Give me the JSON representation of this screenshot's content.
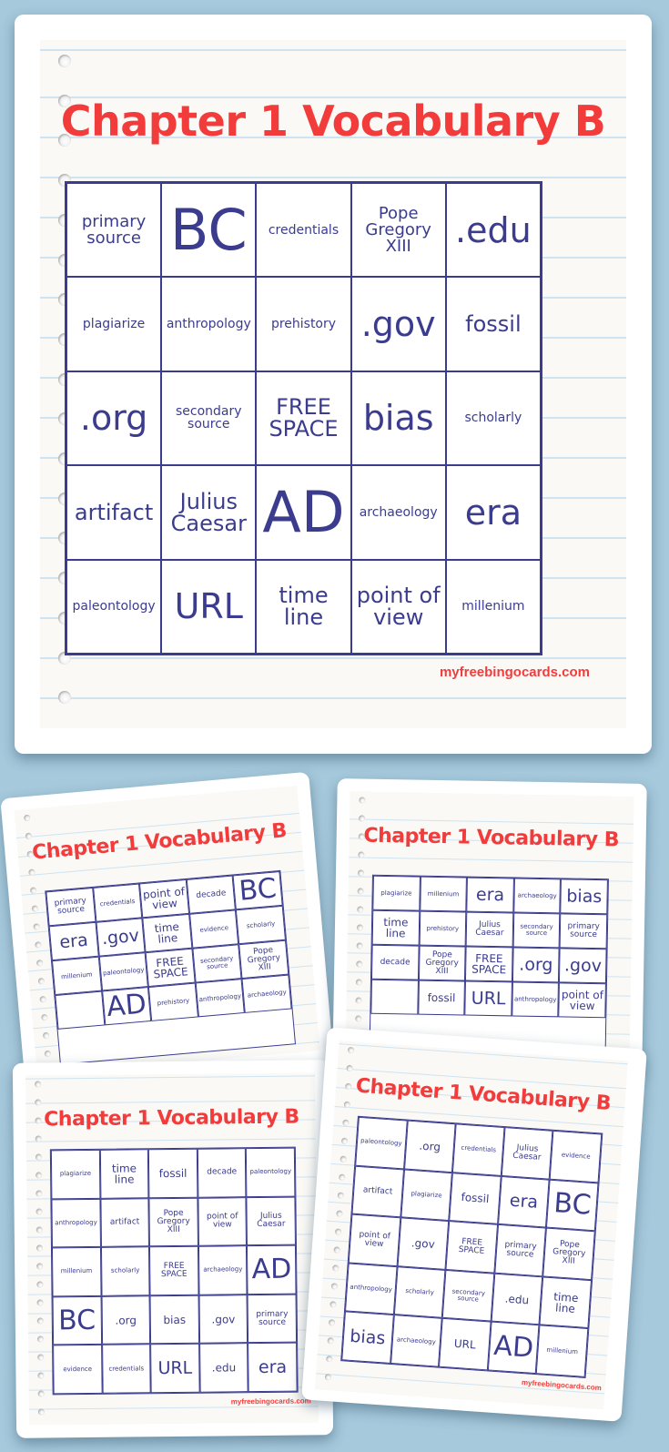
{
  "colors": {
    "background": "#a6c9dc",
    "title": "#f23c3c",
    "grid_ink": "#3b3c8e",
    "paper": "#faf9f6",
    "rule_line": "#cfe3f1"
  },
  "main_card": {
    "title": "Chapter 1 Vocabulary B",
    "brand": "myfreebingocards.com",
    "cells": [
      {
        "text": "primary source",
        "size": "s"
      },
      {
        "text": "BC",
        "size": "xl"
      },
      {
        "text": "credentials",
        "size": "xs"
      },
      {
        "text": "Pope Gregory XIII",
        "size": "s"
      },
      {
        "text": ".edu",
        "size": "l"
      },
      {
        "text": "plagiarize",
        "size": "xs"
      },
      {
        "text": "anthropology",
        "size": "xs"
      },
      {
        "text": "prehistory",
        "size": "xs"
      },
      {
        "text": ".gov",
        "size": "l"
      },
      {
        "text": "fossil",
        "size": "m"
      },
      {
        "text": ".org",
        "size": "l"
      },
      {
        "text": "secondary source",
        "size": "xs"
      },
      {
        "text": "FREE SPACE",
        "size": "m"
      },
      {
        "text": "bias",
        "size": "l"
      },
      {
        "text": "scholarly",
        "size": "xs"
      },
      {
        "text": "artifact",
        "size": "m"
      },
      {
        "text": "Julius Caesar",
        "size": "m"
      },
      {
        "text": "AD",
        "size": "xl"
      },
      {
        "text": "archaeology",
        "size": "xs"
      },
      {
        "text": "era",
        "size": "l"
      },
      {
        "text": "paleontology",
        "size": "xs"
      },
      {
        "text": "URL",
        "size": "l"
      },
      {
        "text": "time line",
        "size": "m"
      },
      {
        "text": "point of view",
        "size": "m"
      },
      {
        "text": "millenium",
        "size": "xs"
      }
    ]
  },
  "preview_cards": [
    {
      "title": "Chapter 1 Vocabulary B",
      "brand": "",
      "cells": [
        {
          "text": "primary source",
          "size": "s"
        },
        {
          "text": "credentials",
          "size": "xs"
        },
        {
          "text": "point of view",
          "size": "m"
        },
        {
          "text": "decade",
          "size": "s"
        },
        {
          "text": "BC",
          "size": "xl"
        },
        {
          "text": "era",
          "size": "l"
        },
        {
          "text": ".gov",
          "size": "l"
        },
        {
          "text": "time line",
          "size": "m"
        },
        {
          "text": "evidence",
          "size": "xs"
        },
        {
          "text": "scholarly",
          "size": "xs"
        },
        {
          "text": "millenium",
          "size": "xs"
        },
        {
          "text": "paleontology",
          "size": "xs"
        },
        {
          "text": "FREE SPACE",
          "size": "m"
        },
        {
          "text": "secondary source",
          "size": "xs"
        },
        {
          "text": "Pope Gregory XIII",
          "size": "s"
        },
        {
          "text": "",
          "size": "m"
        },
        {
          "text": "AD",
          "size": "xl"
        },
        {
          "text": "prehistory",
          "size": "xs"
        },
        {
          "text": "anthropology",
          "size": "xs"
        },
        {
          "text": "archaeology",
          "size": "xs"
        }
      ]
    },
    {
      "title": "Chapter 1 Vocabulary B",
      "brand": "",
      "cells": [
        {
          "text": "plagiarize",
          "size": "xs"
        },
        {
          "text": "millenium",
          "size": "xs"
        },
        {
          "text": "era",
          "size": "l"
        },
        {
          "text": "archaeology",
          "size": "xs"
        },
        {
          "text": "bias",
          "size": "l"
        },
        {
          "text": "time line",
          "size": "m"
        },
        {
          "text": "prehistory",
          "size": "xs"
        },
        {
          "text": "Julius Caesar",
          "size": "s"
        },
        {
          "text": "secondary source",
          "size": "xs"
        },
        {
          "text": "primary source",
          "size": "s"
        },
        {
          "text": "decade",
          "size": "s"
        },
        {
          "text": "Pope Gregory XIII",
          "size": "s"
        },
        {
          "text": "FREE SPACE",
          "size": "m"
        },
        {
          "text": ".org",
          "size": "l"
        },
        {
          "text": ".gov",
          "size": "l"
        },
        {
          "text": "",
          "size": "m"
        },
        {
          "text": "fossil",
          "size": "m"
        },
        {
          "text": "URL",
          "size": "l"
        },
        {
          "text": "anthropology",
          "size": "xs"
        },
        {
          "text": "point of view",
          "size": "m"
        }
      ]
    },
    {
      "title": "Chapter 1 Vocabulary B",
      "brand": "myfreebingocards.com",
      "cells": [
        {
          "text": "plagiarize",
          "size": "xs"
        },
        {
          "text": "time line",
          "size": "m"
        },
        {
          "text": "fossil",
          "size": "m"
        },
        {
          "text": "decade",
          "size": "s"
        },
        {
          "text": "paleontology",
          "size": "xs"
        },
        {
          "text": "anthropology",
          "size": "xs"
        },
        {
          "text": "artifact",
          "size": "s"
        },
        {
          "text": "Pope Gregory XIII",
          "size": "s"
        },
        {
          "text": "point of view",
          "size": "s"
        },
        {
          "text": "Julius Caesar",
          "size": "s"
        },
        {
          "text": "millenium",
          "size": "xs"
        },
        {
          "text": "scholarly",
          "size": "xs"
        },
        {
          "text": "FREE SPACE",
          "size": "s"
        },
        {
          "text": "archaeology",
          "size": "xs"
        },
        {
          "text": "AD",
          "size": "xl"
        },
        {
          "text": "BC",
          "size": "xl"
        },
        {
          "text": ".org",
          "size": "m"
        },
        {
          "text": "bias",
          "size": "m"
        },
        {
          "text": ".gov",
          "size": "m"
        },
        {
          "text": "primary source",
          "size": "s"
        },
        {
          "text": "evidence",
          "size": "xs"
        },
        {
          "text": "credentials",
          "size": "xs"
        },
        {
          "text": "URL",
          "size": "l"
        },
        {
          "text": ".edu",
          "size": "m"
        },
        {
          "text": "era",
          "size": "l"
        }
      ]
    },
    {
      "title": "Chapter 1 Vocabulary B",
      "brand": "myfreebingocards.com",
      "cells": [
        {
          "text": "paleontology",
          "size": "xs"
        },
        {
          "text": ".org",
          "size": "m"
        },
        {
          "text": "credentials",
          "size": "xs"
        },
        {
          "text": "Julius Caesar",
          "size": "s"
        },
        {
          "text": "evidence",
          "size": "xs"
        },
        {
          "text": "artifact",
          "size": "s"
        },
        {
          "text": "plagiarize",
          "size": "xs"
        },
        {
          "text": "fossil",
          "size": "m"
        },
        {
          "text": "era",
          "size": "l"
        },
        {
          "text": "BC",
          "size": "xl"
        },
        {
          "text": "point of view",
          "size": "s"
        },
        {
          "text": ".gov",
          "size": "m"
        },
        {
          "text": "FREE SPACE",
          "size": "s"
        },
        {
          "text": "primary source",
          "size": "s"
        },
        {
          "text": "Pope Gregory XIII",
          "size": "s"
        },
        {
          "text": "anthropology",
          "size": "xs"
        },
        {
          "text": "scholarly",
          "size": "xs"
        },
        {
          "text": "secondary source",
          "size": "xs"
        },
        {
          "text": ".edu",
          "size": "m"
        },
        {
          "text": "time line",
          "size": "m"
        },
        {
          "text": "bias",
          "size": "l"
        },
        {
          "text": "archaeology",
          "size": "xs"
        },
        {
          "text": "URL",
          "size": "m"
        },
        {
          "text": "AD",
          "size": "xl"
        },
        {
          "text": "millenium",
          "size": "xs"
        }
      ]
    }
  ]
}
